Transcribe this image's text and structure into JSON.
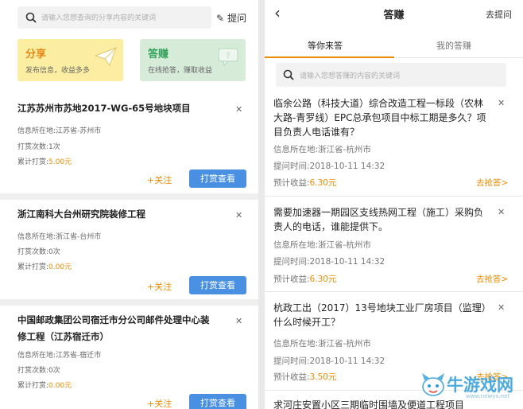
{
  "left": {
    "search_placeholder": "请输入您想查询的分享内容的关键词",
    "ask_label": "提问",
    "cards": {
      "share": {
        "title": "分享",
        "subtitle": "发布信息，收益多多"
      },
      "answer": {
        "title": "答赚",
        "subtitle": "在线抢答，赚取收益"
      }
    },
    "items": [
      {
        "title": "江苏苏州市苏地2017-WG-65号地块项目",
        "location_label": "信息所在地:",
        "location": "江苏省-苏州市",
        "count_label": "打赏次数:",
        "count": "1次",
        "total_label": "累计打赏:",
        "total": "5.00元",
        "follow": "关注",
        "reward_btn": "打赏查看"
      },
      {
        "title": "浙江南科大台州研究院装修工程",
        "location_label": "信息所在地:",
        "location": "浙江省-台州市",
        "count_label": "打赏次数:",
        "count": "0次",
        "total_label": "累计打赏:",
        "total": "0.00元",
        "follow": "关注",
        "reward_btn": "打赏查看"
      },
      {
        "title": "中国邮政集团公司宿迁市分公司邮件处理中心装修工程（江苏宿迁市）",
        "location_label": "信息所在地:",
        "location": "江苏省-宿迁市",
        "count_label": "打赏次数:",
        "count": "0次",
        "total_label": "累计打赏:",
        "total": "0.00元",
        "follow": "关注",
        "reward_btn": "打赏查看"
      }
    ]
  },
  "right": {
    "title": "答赚",
    "go_ask": "去提问",
    "tabs": [
      "等你来答",
      "我的答赚"
    ],
    "search_placeholder": "请输入您想答赚的内容的关键词",
    "questions": [
      {
        "title": "临余公路（科技大道）综合改造工程一标段（农林大路-青罗线）EPC总承包项目中标工期是多久？项目负责人电话谁有？",
        "location_label": "信息所在地:",
        "location": "浙江省-杭州市",
        "time_label": "提问时间:",
        "time": "2018-10-11 14:32",
        "earn_label": "预计收益:",
        "earn": "6.30元",
        "grab": "去抢答>"
      },
      {
        "title": "需要加速器一期园区支线热网工程（施工）采购负责人的电话，谁能提供下。",
        "location_label": "信息所在地:",
        "location": "浙江省-杭州市",
        "time_label": "提问时间:",
        "time": "2018-10-11 14:32",
        "earn_label": "预计收益:",
        "earn": "6.30元",
        "grab": "去抢答>"
      },
      {
        "title": "杭政工出（2017）13号地块工业厂房项目（监理）什么时候开工？",
        "location_label": "信息所在地:",
        "location": "浙江省-杭州市",
        "time_label": "提问时间:",
        "time": "2018-10-11 14:32",
        "earn_label": "预计收益:",
        "earn": "3.50元",
        "grab": "去抢答>"
      },
      {
        "title": "求河庄安置小区三期临时围墙及便道工程项目"
      }
    ]
  },
  "watermark": {
    "text": "牛游戏网",
    "url": "www.newyx.net"
  },
  "colors": {
    "accent": "#f08a00",
    "button_blue": "#4a90e2",
    "share_card": "#fbeea2",
    "answer_card": "#d6ecd9",
    "share_title": "#e48a1a",
    "answer_title": "#34a25a"
  }
}
